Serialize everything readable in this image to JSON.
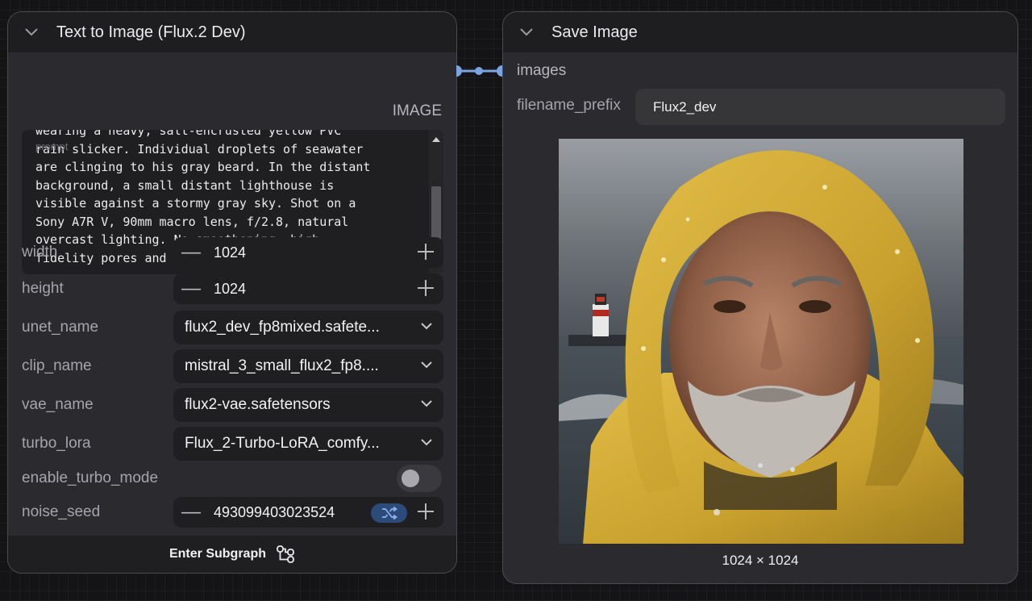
{
  "left_node": {
    "title": "Text to Image (Flux.2 Dev)",
    "output_label": "IMAGE",
    "prompt_text": "wearing a heavy, salt-encrusted yellow PVC\nrain slicker. Individual droplets of seawater\nare clinging to his gray beard. In the distant\nbackground, a small distant lighthouse is\nvisible against a stormy gray sky. Shot on a\nSony A7R V, 90mm macro lens, f/2.8, natural\novercast lighting. No smoothening, high-\nfidelity pores and skin imperfections visible.",
    "prompt_placeholder": "prompt",
    "width": {
      "label": "width",
      "value": "1024"
    },
    "height": {
      "label": "height",
      "value": "1024"
    },
    "unet_name": {
      "label": "unet_name",
      "value": "flux2_dev_fp8mixed.safete..."
    },
    "clip_name": {
      "label": "clip_name",
      "value": "mistral_3_small_flux2_fp8...."
    },
    "vae_name": {
      "label": "vae_name",
      "value": "flux2-vae.safetensors"
    },
    "turbo_lora": {
      "label": "turbo_lora",
      "value": "Flux_2-Turbo-LoRA_comfy..."
    },
    "enable_turbo_mode": {
      "label": "enable_turbo_mode",
      "value": false
    },
    "noise_seed": {
      "label": "noise_seed",
      "value": "493099403023524"
    },
    "footer_label": "Enter Subgraph"
  },
  "right_node": {
    "title": "Save Image",
    "input_label": "images",
    "filename_prefix": {
      "label": "filename_prefix",
      "value": "Flux2_dev"
    },
    "image_dims": "1024 × 1024"
  },
  "colors": {
    "link": "#7ba4e0",
    "canvas": "#141416",
    "node": "#2b2b2f",
    "accent_button": "#2c4a7a",
    "raincoat": "#d9b23a"
  }
}
